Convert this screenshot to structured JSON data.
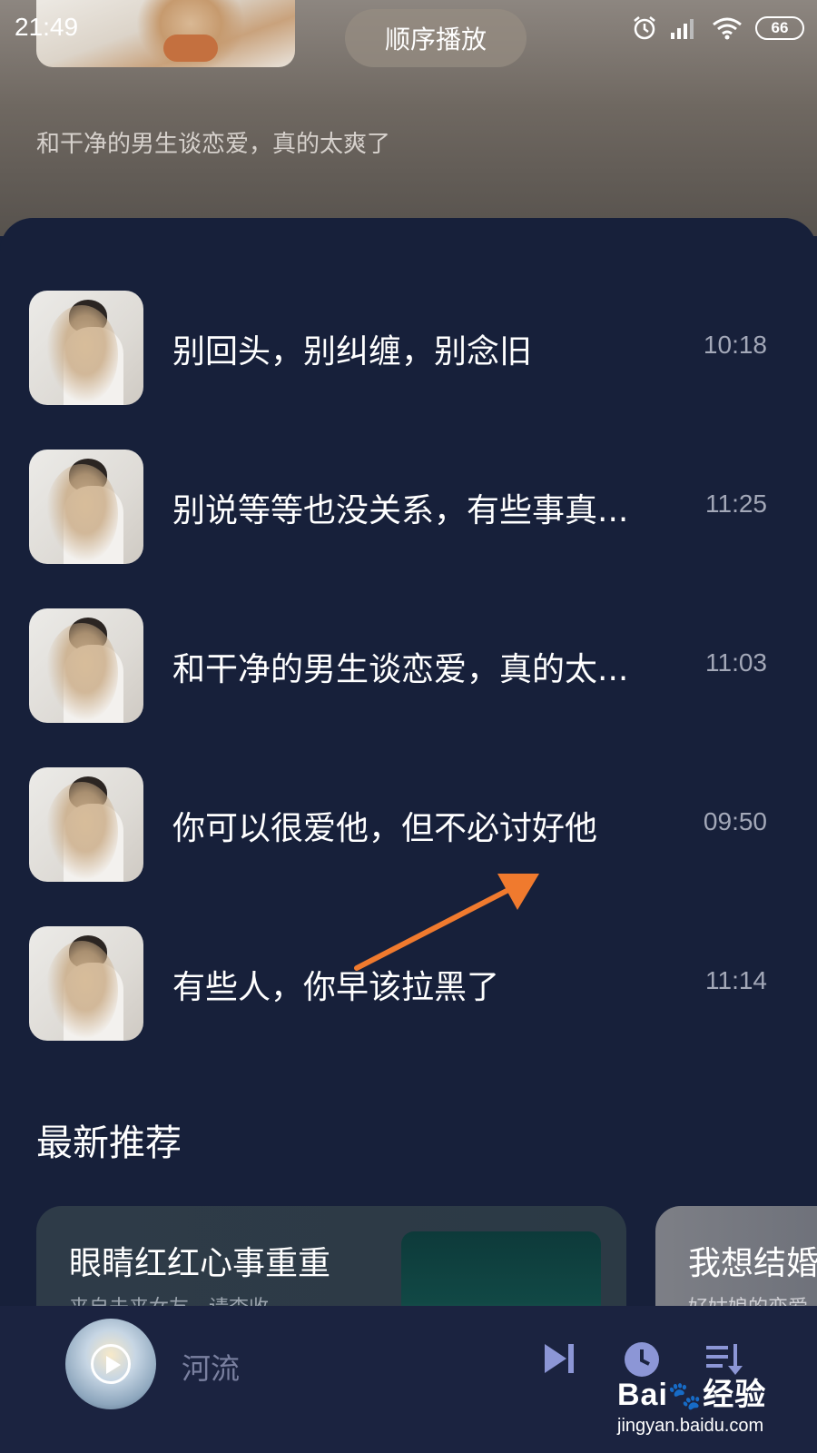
{
  "status_bar": {
    "time": "21:49",
    "battery": "66"
  },
  "header": {
    "play_mode": "顺序播放",
    "subtitle": "和干净的男生谈恋爱，真的太爽了"
  },
  "tracks": [
    {
      "title": "别回头，别纠缠，别念旧",
      "duration": "10:18"
    },
    {
      "title": "别说等等也没关系，有些事真...",
      "duration": "11:25"
    },
    {
      "title": "和干净的男生谈恋爱，真的太...",
      "duration": "11:03"
    },
    {
      "title": "你可以很爱他，但不必讨好他",
      "duration": "09:50"
    },
    {
      "title": "有些人，你早该拉黑了",
      "duration": "11:14"
    }
  ],
  "recommend": {
    "title": "最新推荐",
    "cards": [
      {
        "title": "眼睛红红心事重重",
        "subtitle": "来自未来女友，请查收"
      },
      {
        "title": "我想结婚",
        "subtitle": "好姑娘的恋爱"
      }
    ]
  },
  "player": {
    "title": "河流"
  },
  "watermark": {
    "brand": "Bai",
    "brand2": "经验",
    "url": "jingyan.baidu.com"
  },
  "colors": {
    "panel_bg": "#17203a",
    "player_bg": "#1b2340",
    "icon_accent": "#8c96d6",
    "annotation_arrow": "#f07a2e"
  },
  "icons": [
    "alarm-icon",
    "signal-icon",
    "wifi-icon",
    "next-track-icon",
    "timer-icon",
    "playlist-icon",
    "play-icon"
  ]
}
